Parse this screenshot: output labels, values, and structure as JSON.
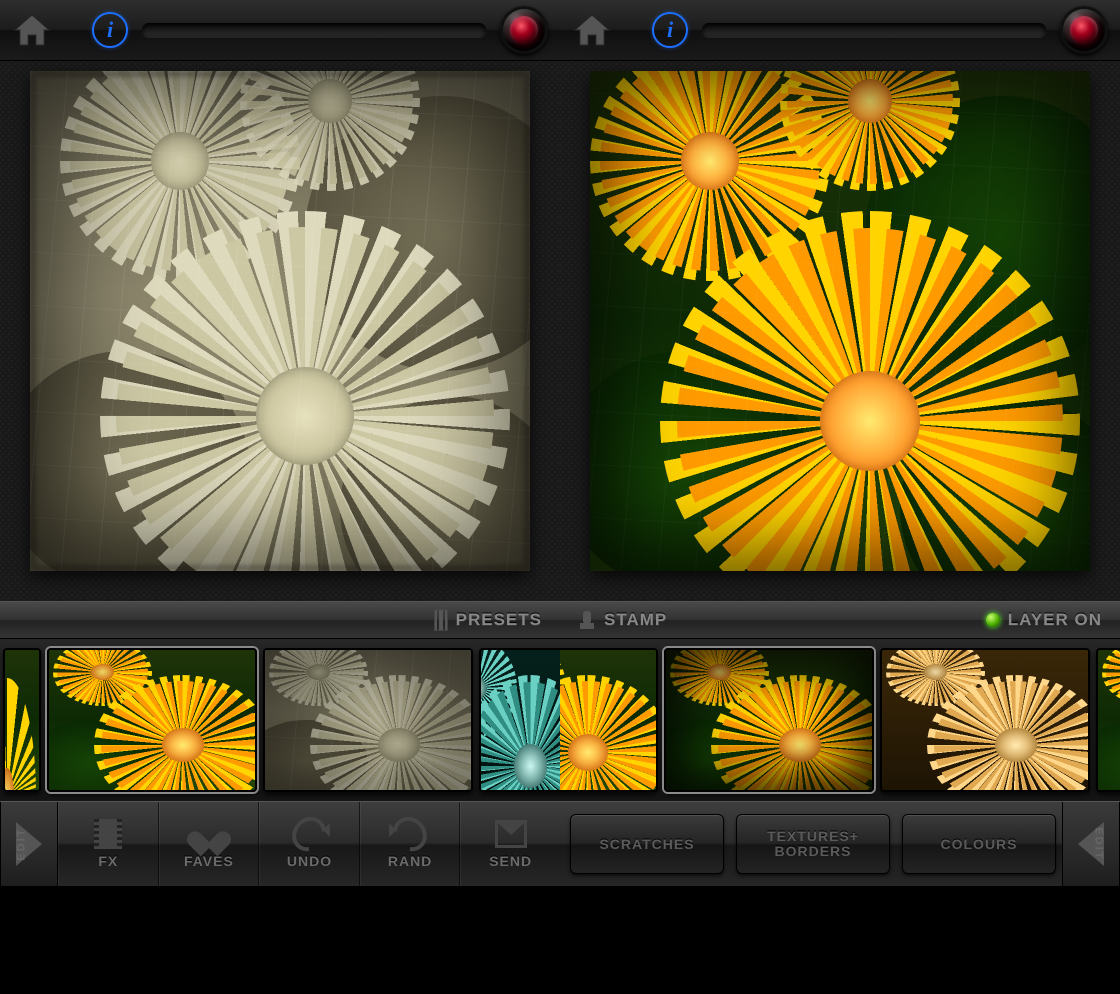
{
  "left": {
    "strip_label": "PRESETS",
    "toolbar": {
      "edit": "EDIT",
      "fx": "FX",
      "faves": "FAVES",
      "undo": "UNDO",
      "rand": "RAND",
      "send": "SEND"
    }
  },
  "right": {
    "strip_label_left": "STAMP",
    "strip_label_right": "LAYER ON",
    "toolbar": {
      "btn1": "SCRATCHES",
      "btn2a": "TEXTURES+",
      "btn2b": "BORDERS",
      "btn3": "COLOURS",
      "edit": "EDIT"
    }
  },
  "info_glyph": "i"
}
